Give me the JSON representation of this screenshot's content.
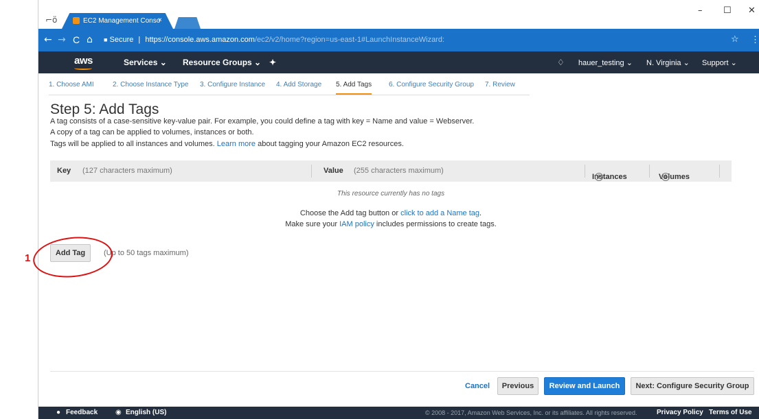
{
  "annotation": {
    "number": "1"
  },
  "browser": {
    "tab_title": "EC2 Management Conso",
    "tab_close": "×",
    "incognito_icon": "incognito-icon",
    "window_minimize": "–",
    "window_maximize": "☐",
    "window_close": "✕",
    "nav_back": "←",
    "nav_forward": "→",
    "nav_reload": "C",
    "nav_home": "⌂",
    "lock": "🔒",
    "secure_label": "Secure",
    "url_scheme": "https://",
    "url_host": "console.aws.amazon.com",
    "url_path": "/ec2/v2/home?region=us-east-1#LaunchInstanceWizard:",
    "star": "☆",
    "menu": "⋮"
  },
  "aws_nav": {
    "logo": "aws",
    "services": "Services ⌄",
    "resource_groups": "Resource Groups ⌄",
    "pin": "✦",
    "bell": "🔔",
    "account": "hauer_testing ⌄",
    "region": "N. Virginia ⌄",
    "support": "Support ⌄"
  },
  "steps": [
    {
      "label": "1. Choose AMI"
    },
    {
      "label": "2. Choose Instance Type"
    },
    {
      "label": "3. Configure Instance"
    },
    {
      "label": "4. Add Storage"
    },
    {
      "label": "5. Add Tags"
    },
    {
      "label": "6. Configure Security Group"
    },
    {
      "label": "7. Review"
    }
  ],
  "page": {
    "title": "Step 5: Add Tags",
    "desc1": "A tag consists of a case-sensitive key-value pair. For example, you could define a tag with key = Name and value = Webserver.",
    "desc2": "A copy of a tag can be applied to volumes, instances or both.",
    "desc3_before": "Tags will be applied to all instances and volumes.",
    "desc3_link": "Learn more",
    "desc3_after": "about tagging your Amazon EC2 resources."
  },
  "table": {
    "key_header": "Key",
    "key_note": "(127 characters maximum)",
    "value_header": "Value",
    "value_note": "(255 characters maximum)",
    "instances_header": "Instances",
    "volumes_header": "Volumes",
    "info_icon": "i",
    "empty_text": "This resource currently has no tags",
    "hint1_before": "Choose the Add tag button or",
    "hint1_link": "click to add a Name tag",
    "hint1_after": ".",
    "hint2_before": "Make sure your",
    "hint2_link": "IAM policy",
    "hint2_after": "includes permissions to create tags."
  },
  "actions": {
    "add_tag": "Add Tag",
    "add_tag_note": "(Up to 50 tags maximum)",
    "cancel": "Cancel",
    "previous": "Previous",
    "review_launch": "Review and Launch",
    "next": "Next: Configure Security Group"
  },
  "footer": {
    "feedback": "Feedback",
    "language": "English (US)",
    "copyright": "© 2008 - 2017, Amazon Web Services, Inc. or its affiliates. All rights reserved.",
    "privacy": "Privacy Policy",
    "terms": "Terms of Use"
  }
}
